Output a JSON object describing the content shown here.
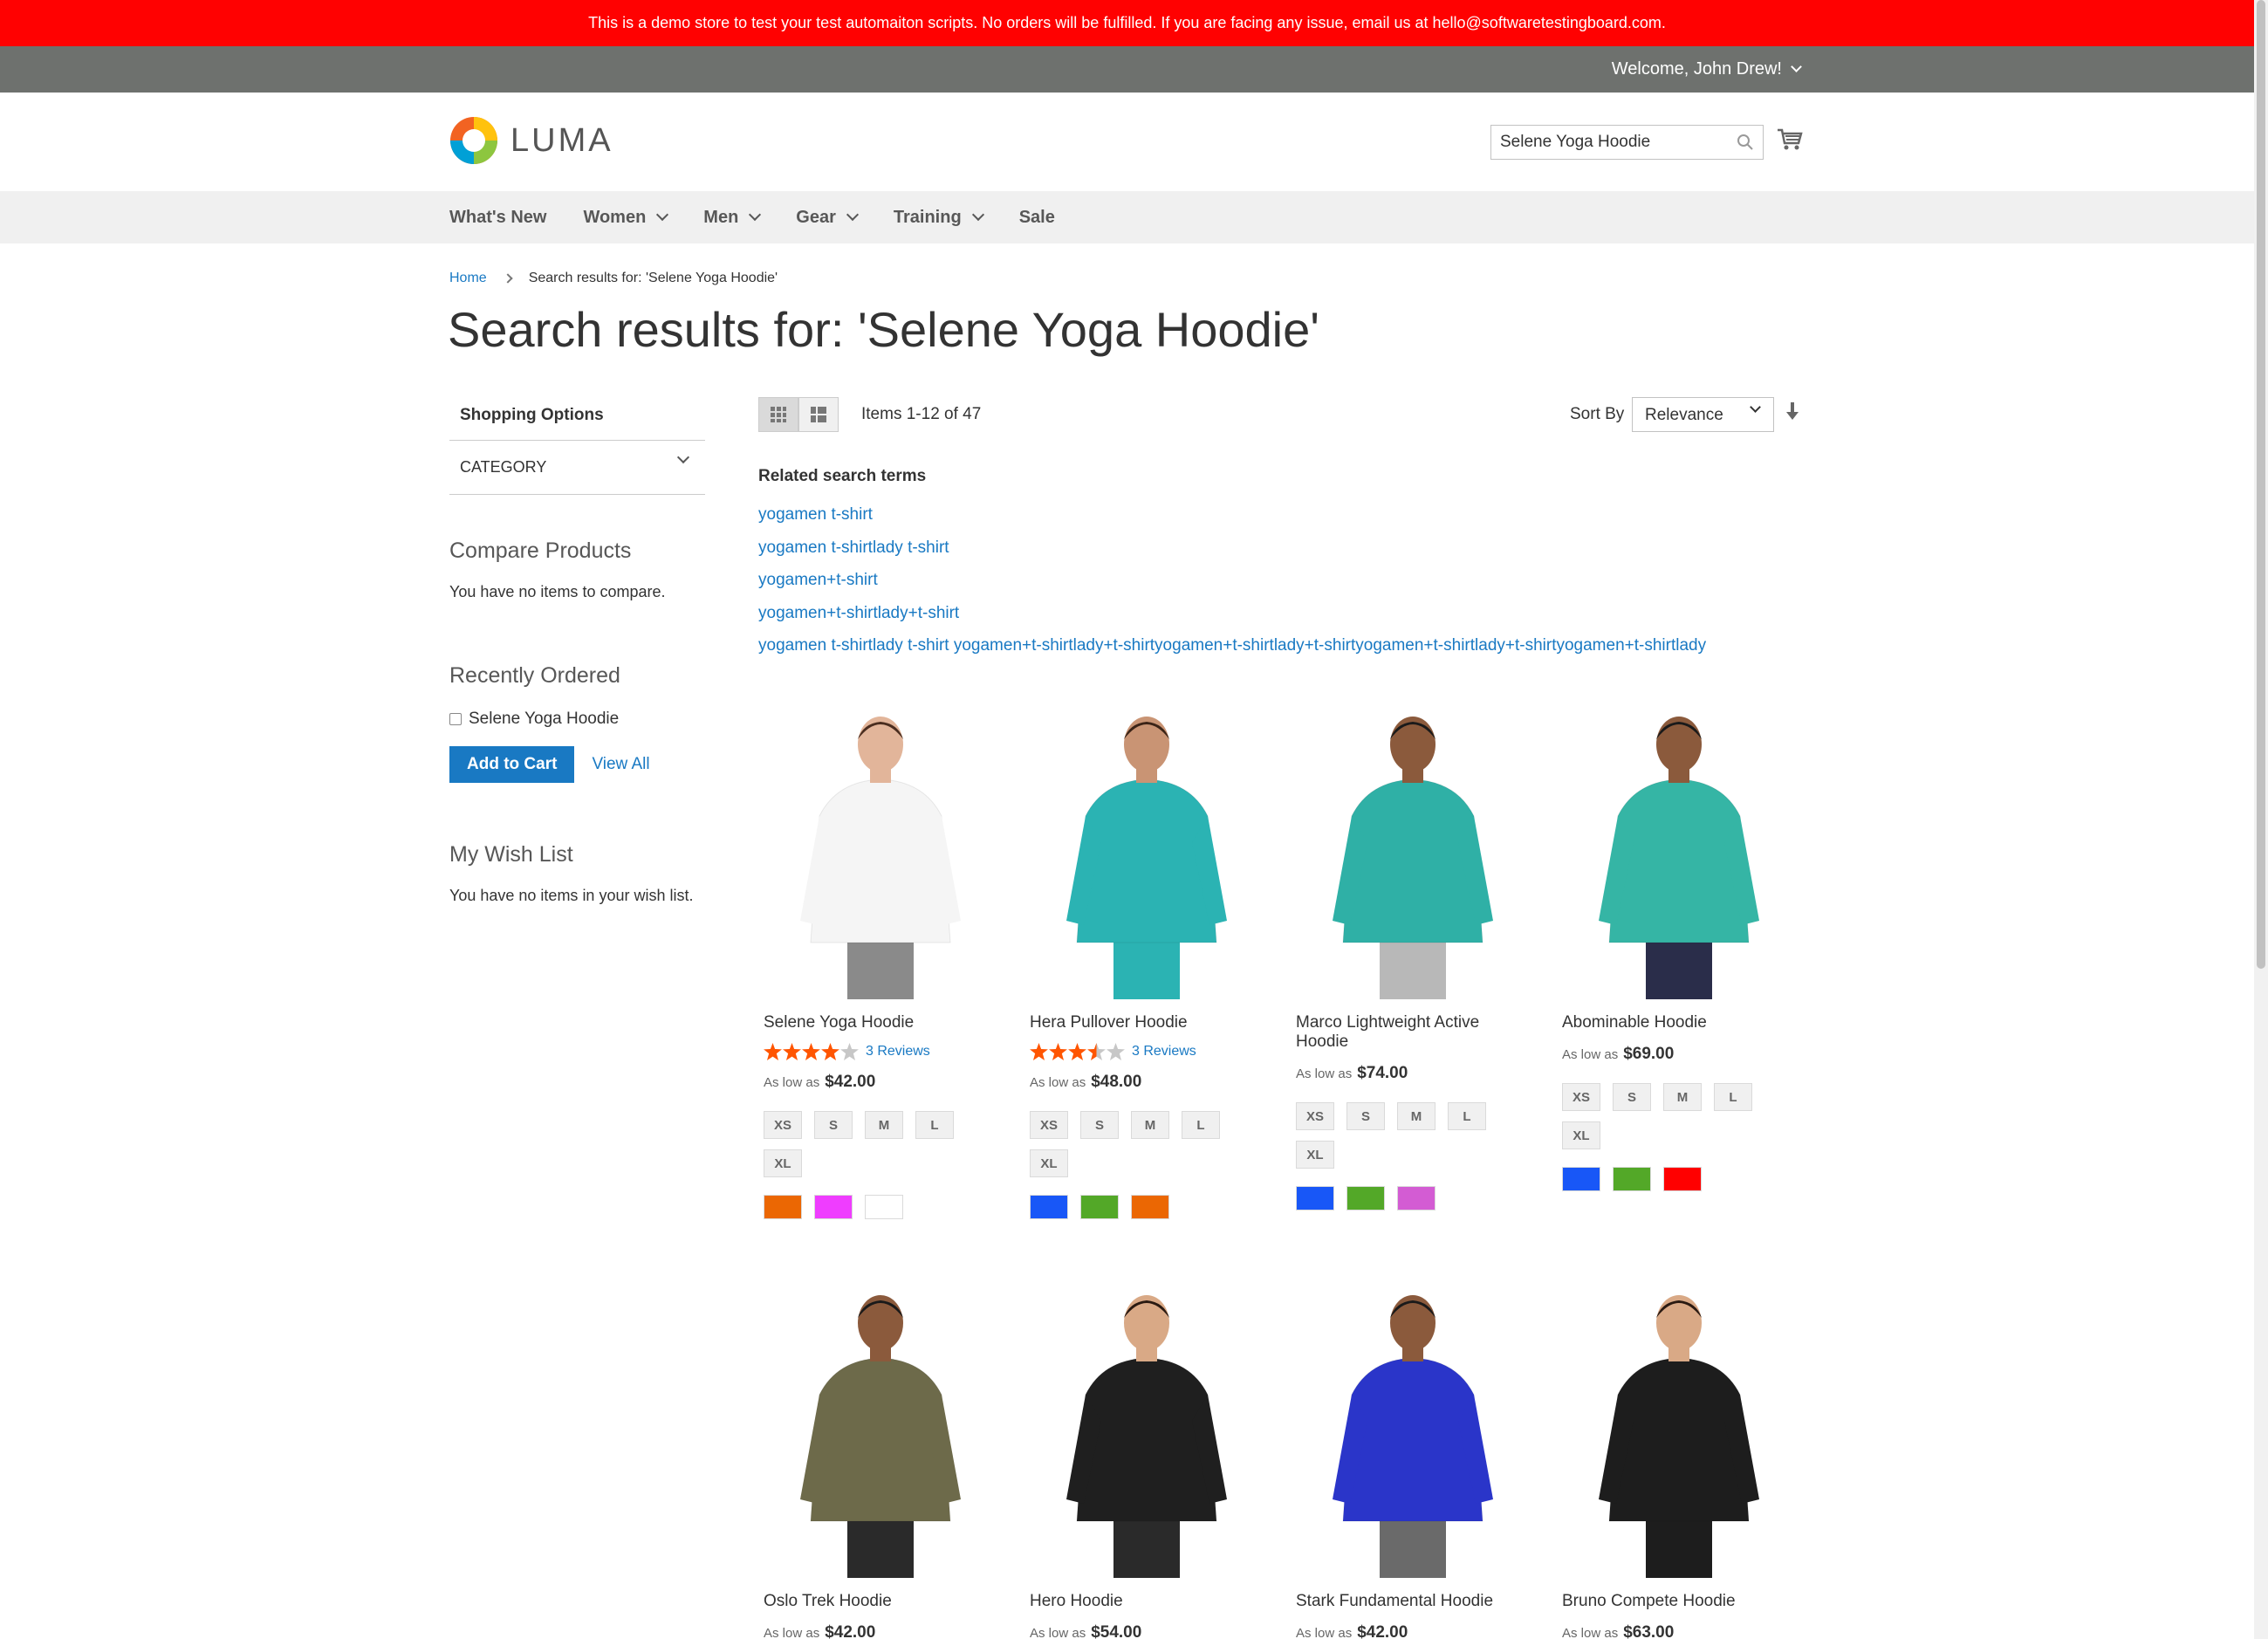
{
  "demo_notice": "This is a demo store to test your test automaiton scripts. No orders will be fulfilled. If you are facing any issue, email us at hello@softwaretestingboard.com.",
  "welcome": "Welcome, John Drew!",
  "logo_text": "LUMA",
  "search": {
    "value": "Selene Yoga Hoodie"
  },
  "nav": [
    "What's New",
    "Women",
    "Men",
    "Gear",
    "Training",
    "Sale"
  ],
  "breadcrumb": {
    "home": "Home",
    "current": "Search results for: 'Selene Yoga Hoodie'"
  },
  "page_title": "Search results for: 'Selene Yoga Hoodie'",
  "sidebar": {
    "shopping_options": "Shopping Options",
    "category": "CATEGORY",
    "compare_title": "Compare Products",
    "compare_text": "You have no items to compare.",
    "recent_title": "Recently Ordered",
    "recent_item": "Selene Yoga Hoodie",
    "add_to_cart": "Add to Cart",
    "view_all": "View All",
    "wish_title": "My Wish List",
    "wish_text": "You have no items in your wish list."
  },
  "toolbar": {
    "amount": "Items 1-12 of 47",
    "sort_label": "Sort By",
    "sort_value": "Relevance"
  },
  "related": {
    "title": "Related search terms",
    "terms": [
      "yogamen t-shirt",
      "yogamen t-shirtlady t-shirt",
      "yogamen+t-shirt",
      "yogamen+t-shirtlady+t-shirt",
      "yogamen t-shirtlady t-shirt yogamen+t-shirtlady+t-shirtyogamen+t-shirtlady+t-shirtyogamen+t-shirtlady+t-shirtyogamen+t-shirtlady"
    ]
  },
  "products": [
    {
      "name": "Selene Yoga Hoodie",
      "rating": 4,
      "reviews": "3 Reviews",
      "price_label": "As low as",
      "price": "$42.00",
      "sizes": [
        "XS",
        "S",
        "M",
        "L",
        "XL"
      ],
      "colors": [
        "#eb6703",
        "#ef3dff",
        "#ffffff"
      ]
    },
    {
      "name": "Hera Pullover Hoodie",
      "rating": 3.5,
      "reviews": "3 Reviews",
      "price_label": "As low as",
      "price": "$48.00",
      "sizes": [
        "XS",
        "S",
        "M",
        "L",
        "XL"
      ],
      "colors": [
        "#1857f7",
        "#53a828",
        "#eb6703"
      ]
    },
    {
      "name": "Marco Lightweight Active Hoodie",
      "price_label": "As low as",
      "price": "$74.00",
      "sizes": [
        "XS",
        "S",
        "M",
        "L",
        "XL"
      ],
      "colors": [
        "#1857f7",
        "#53a828",
        "#d35cd3"
      ]
    },
    {
      "name": "Abominable Hoodie",
      "price_label": "As low as",
      "price": "$69.00",
      "sizes": [
        "XS",
        "S",
        "M",
        "L",
        "XL"
      ],
      "colors": [
        "#1857f7",
        "#53a828",
        "#ff0000"
      ]
    },
    {
      "name": "Oslo Trek Hoodie",
      "price_label": "As low as",
      "price": "$42.00"
    },
    {
      "name": "Hero Hoodie",
      "price_label": "As low as",
      "price": "$54.00"
    },
    {
      "name": "Stark Fundamental Hoodie",
      "price_label": "As low as",
      "price": "$42.00"
    },
    {
      "name": "Bruno Compete Hoodie",
      "price_label": "As low as",
      "price": "$63.00"
    }
  ]
}
